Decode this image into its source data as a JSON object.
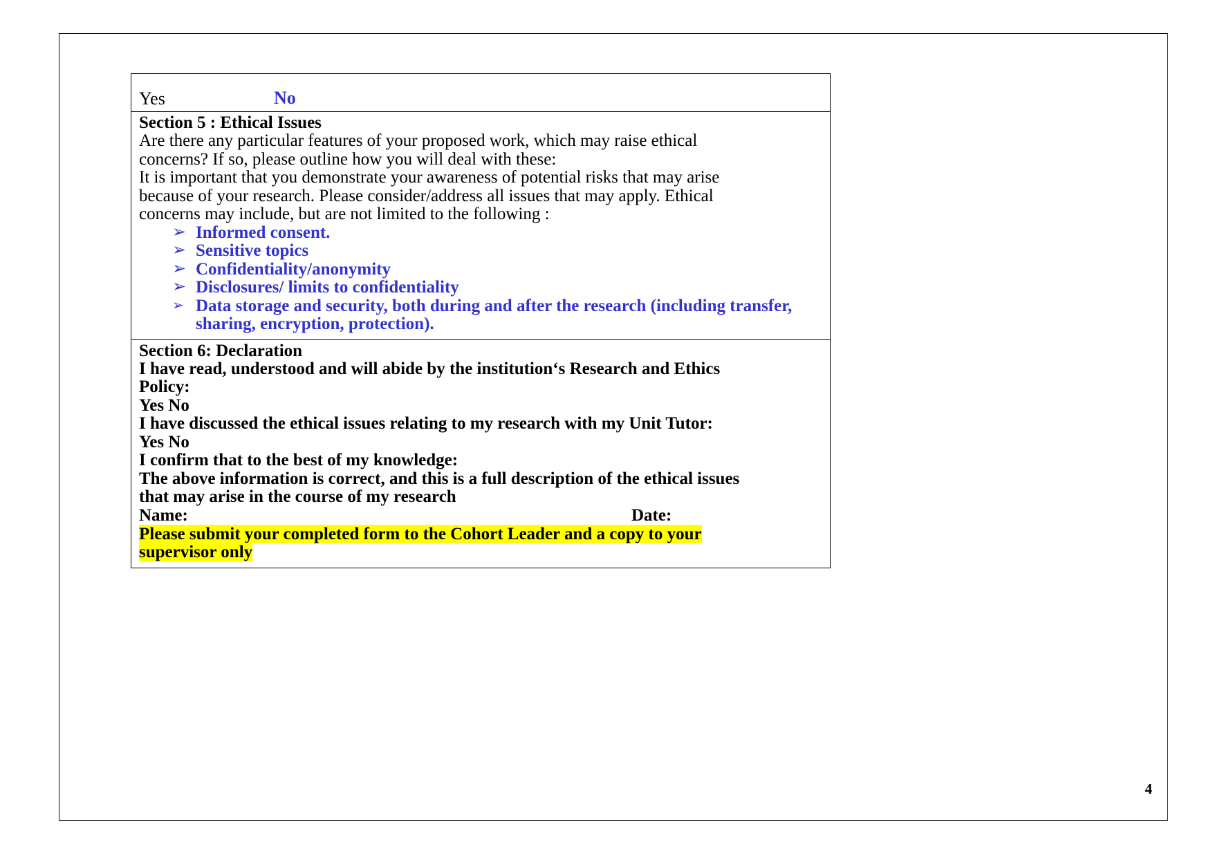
{
  "page": {
    "number": "4"
  },
  "form": {
    "yesno_header": {
      "yes_label": "Yes",
      "no_label": "No"
    },
    "section5": {
      "heading": "Section 5 : Ethical Issues",
      "paragraph1": "Are there any particular features of your proposed work, which may raise ethical concerns? If so, please outline how you will deal with these:",
      "paragraph2": "It is important that you demonstrate your awareness of potential risks that may arise because of your research.  Please consider/address all issues that may apply. Ethical concerns may include, but are not limited to the following :",
      "bullet_glyph": "➢",
      "bullets": [
        "Informed consent.",
        "Sensitive topics",
        "Confidentiality/anonymity",
        "Disclosures/ limits to confidentiality",
        "Data storage and security, both during and after the research (including transfer, sharing, encryption, protection)."
      ]
    },
    "section6": {
      "heading": "Section 6: Declaration",
      "statement1": "I have read, understood and will abide by the institution‘s Research and Ethics Policy:",
      "yesno1": "Yes  No",
      "statement2": "I have discussed the ethical issues relating to my research with my Unit Tutor:",
      "yesno2": "Yes  No",
      "statement3": "I confirm that to the best of my knowledge:",
      "statement4": "The above information is correct, and this is a full description of the ethical issues that may arise in the course of my research",
      "name_label": "Name:",
      "date_label": "Date:",
      "submit_note": "Please submit your completed form to the Cohort Leader and a copy to your supervisor only"
    }
  },
  "colors": {
    "accent_blue": "#3333CC",
    "highlight_yellow": "#FFFF00",
    "text_black": "#000000",
    "border": "#000000"
  }
}
